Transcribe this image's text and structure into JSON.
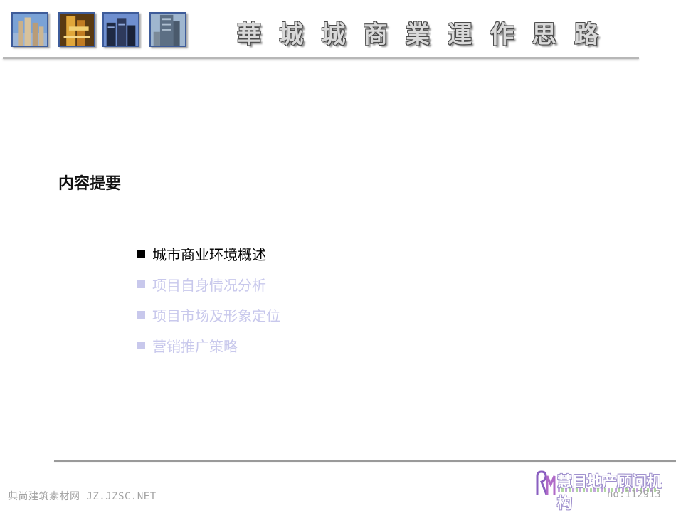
{
  "header": {
    "title_chars": [
      "華",
      "城",
      "城",
      "商",
      "業",
      "運",
      "作",
      "思",
      "路"
    ],
    "thumbnails": [
      "building-photo-1",
      "building-photo-2",
      "building-photo-3",
      "building-photo-4"
    ]
  },
  "heading": "内容提要",
  "toc": {
    "items": [
      {
        "label": "城市商业环境概述",
        "state": "active"
      },
      {
        "label": "项目自身情况分析",
        "state": "dim"
      },
      {
        "label": "项目市场及形象定位",
        "state": "dim"
      },
      {
        "label": "营销推广策略",
        "state": "dim"
      }
    ]
  },
  "footer": {
    "watermark": "典尚建筑素材网 JZ.JZSC.NET",
    "page_no": "no:112913",
    "logo_text": "慧目地产顾问机构"
  },
  "colors": {
    "active_text": "#000000",
    "dim_text": "#c8c8ec",
    "thumb_border": "#3e5c9a",
    "rule": "#b7b7b7"
  }
}
